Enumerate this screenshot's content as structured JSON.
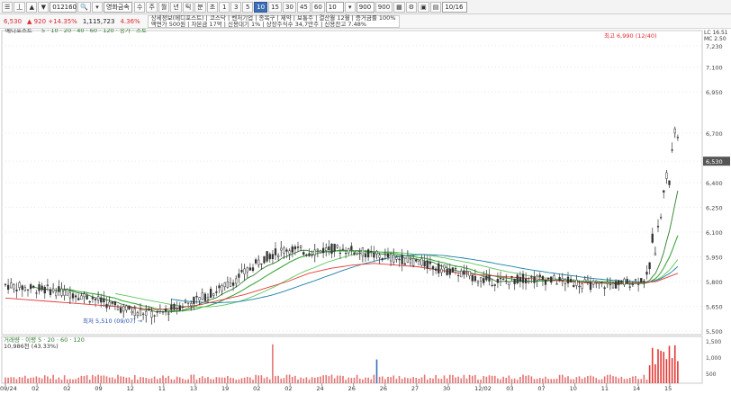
{
  "toolbar": {
    "code_value": "012160",
    "stock_name": "영화금속",
    "period_buttons": [
      "1",
      "3",
      "5",
      "10",
      "15",
      "30",
      "45",
      "60"
    ],
    "period_selected": "10",
    "ticks_value": "10",
    "count_value": "900",
    "count_total": "900",
    "date_value": "10/16",
    "misc_buttons": [
      "수",
      "수",
      "전",
      "주",
      "월",
      "년",
      "틱",
      "분",
      "초"
    ]
  },
  "quote": {
    "price": "6,530",
    "change": "▲ 920 +14.35%",
    "volume": "1,115,723",
    "volume_pct": "4.36%"
  },
  "info_box": {
    "row1": [
      "상세정보(메디포스트)",
      "코스닥",
      "벤처기업",
      "종목구",
      "제약",
      "보통주",
      "결산월 12월",
      "증거금률 100%"
    ],
    "row2": [
      "액면가 500원",
      "자본금 17억",
      "신용대기 1%",
      "상장주식수 34,7만주",
      "신용잔고 7.48%"
    ]
  },
  "legend": {
    "label": "메디포스트",
    "ma_text": "5 · 10 · 20 · 40 · 60 · 120 · 종가 · 스토"
  },
  "annotations": {
    "high_label": "최고 6,990 (12/40)",
    "low_label": "최저 5,510 (09/07)",
    "current_price": "6,530"
  },
  "colors": {
    "candle_up": "#e0282e",
    "candle_down": "#2a2a2a",
    "ma5": "#1a1a1a",
    "ma10": "#2f7d2f",
    "ma20": "#3ba83b",
    "ma40": "#5fc75f",
    "ma60": "#1b7fa8",
    "ma120": "#e53935",
    "accent": "#3d6fb6"
  },
  "price_axis": {
    "labels": [
      "7,230",
      "7,100",
      "6,950",
      "6,700",
      "6,530",
      "6,400",
      "6,250",
      "6,100",
      "5,950",
      "5,800",
      "5,650",
      "5,500"
    ],
    "top_labels": [
      "LC 16.51",
      "MC 2.50"
    ]
  },
  "volume": {
    "header": "거래량 · 이평 5 · 20 · 60 · 120",
    "value_label": "10,986천 (43.33%)",
    "axis_labels": [
      "1,500",
      "1,000",
      "500"
    ]
  },
  "date_axis": [
    "09/24",
    "02",
    "02",
    "09",
    "12",
    "11",
    "13",
    "19",
    "02",
    "02",
    "24",
    "26",
    "26",
    "27",
    "30",
    "12/02",
    "03",
    "07",
    "10",
    "11",
    "14",
    "15"
  ],
  "chart_data": {
    "type": "candlestick",
    "title": "",
    "ylim": [
      5500,
      7300
    ],
    "series": [
      {
        "name": "MA5",
        "values": [
          5780,
          5760,
          5750,
          5730,
          5700,
          5650,
          5620,
          5600,
          5650,
          5700,
          5760,
          5850,
          5950,
          6000,
          5980,
          6000,
          5990,
          5960,
          5940,
          5920,
          5880,
          5850,
          5810,
          5800,
          5820,
          5810,
          5800,
          5780,
          5780,
          5800,
          5850,
          6200
        ]
      },
      {
        "name": "MA120",
        "values": [
          5700,
          5690,
          5680,
          5670,
          5660,
          5650,
          5640,
          5630,
          5640,
          5660,
          5690,
          5720,
          5760,
          5800,
          5850,
          5880,
          5900,
          5910,
          5900,
          5890,
          5870,
          5850,
          5840,
          5830,
          5820,
          5810,
          5800,
          5790,
          5790,
          5790,
          5800,
          5850
        ]
      }
    ]
  }
}
